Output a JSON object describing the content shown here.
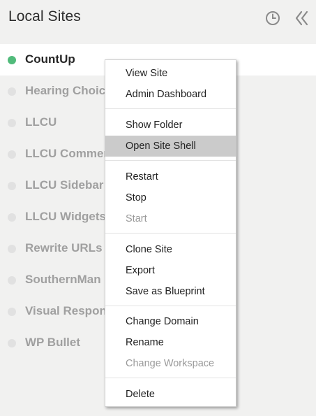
{
  "header": {
    "title": "Local Sites"
  },
  "sites": [
    {
      "name": "CountUp",
      "active": true
    },
    {
      "name": "Hearing Choices",
      "active": false
    },
    {
      "name": "LLCU",
      "active": false
    },
    {
      "name": "LLCU Commerce",
      "active": false
    },
    {
      "name": "LLCU Sidebar Fix",
      "active": false
    },
    {
      "name": "LLCU Widgets",
      "active": false
    },
    {
      "name": "Rewrite URLs",
      "active": false
    },
    {
      "name": "SouthernMan",
      "active": false
    },
    {
      "name": "Visual Responsive",
      "active": false
    },
    {
      "name": "WP Bullet",
      "active": false
    }
  ],
  "context_menu": {
    "view_site": "View Site",
    "admin_dashboard": "Admin Dashboard",
    "show_folder": "Show Folder",
    "open_site_shell": "Open Site Shell",
    "restart": "Restart",
    "stop": "Stop",
    "start": "Start",
    "clone_site": "Clone Site",
    "export": "Export",
    "save_as_blueprint": "Save as Blueprint",
    "change_domain": "Change Domain",
    "rename": "Rename",
    "change_workspace": "Change Workspace",
    "delete": "Delete"
  },
  "icons": {
    "history": "clock-icon",
    "collapse": "double-chevron-left-icon"
  },
  "colors": {
    "running": "#51bb7b",
    "stopped": "#e1e1e1",
    "highlight": "#cbcbcb"
  }
}
